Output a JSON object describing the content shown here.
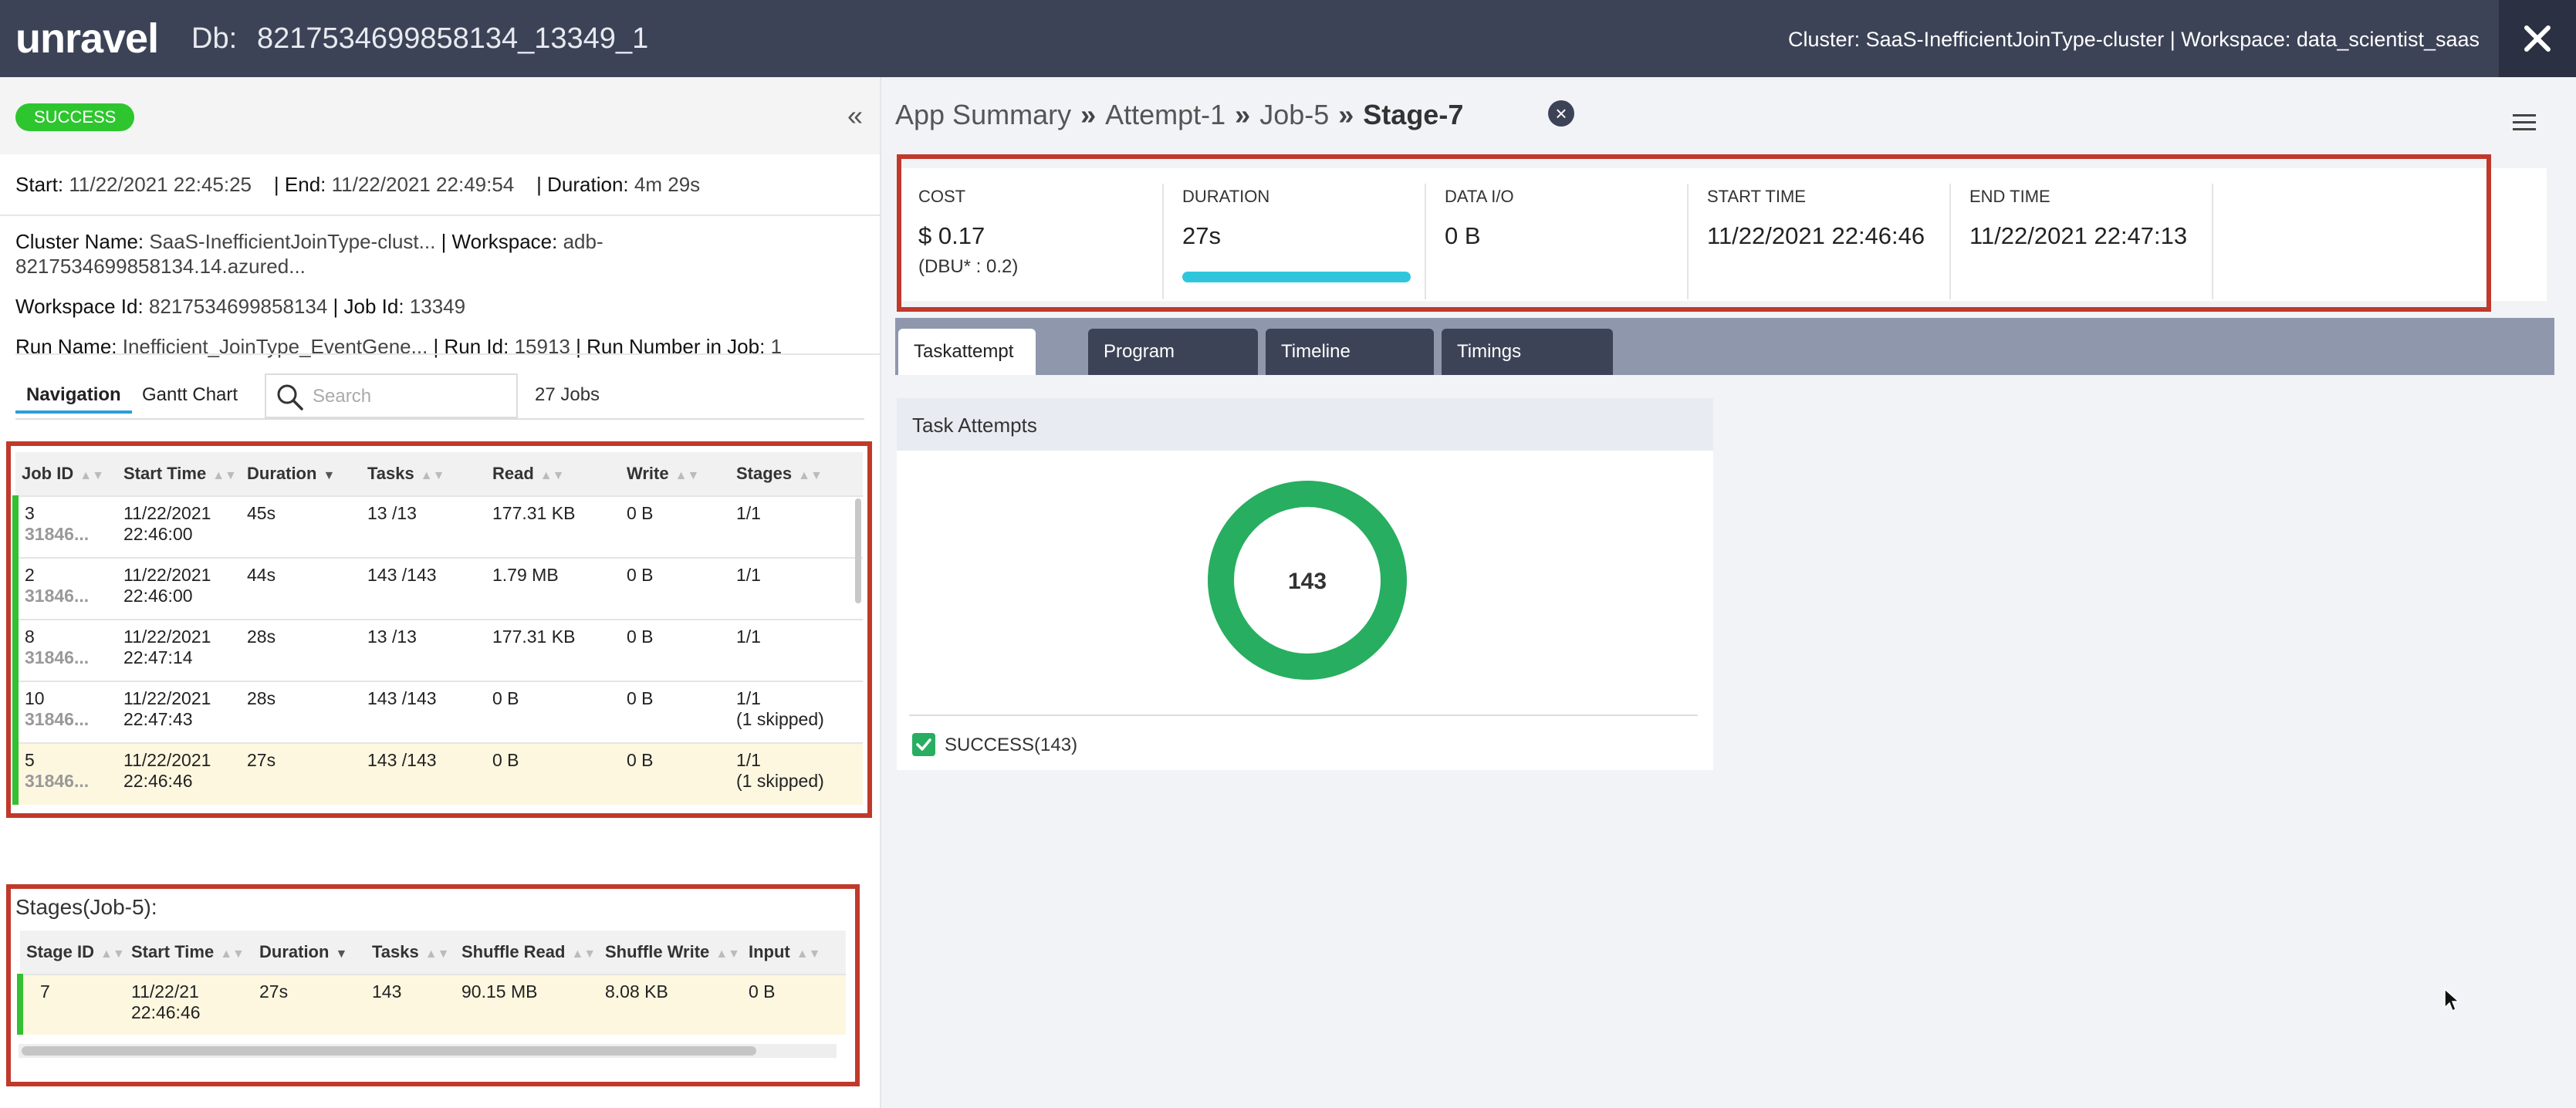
{
  "topbar": {
    "logo": "unravel",
    "db_label": "Db:",
    "db_value": "8217534699858134_13349_1",
    "cluster_workspace": "Cluster: SaaS-InefficientJoinType-cluster | Workspace: data_scientist_saas"
  },
  "status": "SUCCESS",
  "run_info": {
    "start_label": "Start:",
    "start": "11/22/2021 22:45:25",
    "end_label": "| End:",
    "end": "11/22/2021 22:49:54",
    "duration_label": "| Duration:",
    "duration": "4m 29s",
    "cluster_label": "Cluster Name:",
    "cluster": "SaaS-InefficientJoinType-clust...",
    "workspace_label": "| Workspace:",
    "workspace_line1": "adb-",
    "workspace_line2": "8217534699858134.14.azured...",
    "workspace_id_label": "Workspace Id:",
    "workspace_id": "8217534699858134",
    "job_id_label": "| Job Id:",
    "job_id": "13349",
    "run_name_label": "Run Name:",
    "run_name": "Inefficient_JoinType_EventGene...",
    "run_id_label": "| Run Id:",
    "run_id": "15913",
    "run_number_label": "| Run Number in Job:",
    "run_number": "1"
  },
  "nav": {
    "tabs": [
      "Navigation",
      "Gantt Chart"
    ],
    "search_placeholder": "Search",
    "jobs_count": "27 Jobs"
  },
  "jobs_table": {
    "columns": [
      "Job ID",
      "Start Time",
      "Duration",
      "Tasks",
      "Read",
      "Write",
      "Stages"
    ],
    "rows": [
      {
        "id": "3",
        "sub": "31846...",
        "start1": "11/22/2021",
        "start2": "22:46:00",
        "duration": "45s",
        "tasks": "13 /13",
        "read": "177.31 KB",
        "write": "0 B",
        "stages": "1/1",
        "stages_note": ""
      },
      {
        "id": "2",
        "sub": "31846...",
        "start1": "11/22/2021",
        "start2": "22:46:00",
        "duration": "44s",
        "tasks": "143 /143",
        "read": "1.79 MB",
        "write": "0 B",
        "stages": "1/1",
        "stages_note": ""
      },
      {
        "id": "8",
        "sub": "31846...",
        "start1": "11/22/2021",
        "start2": "22:47:14",
        "duration": "28s",
        "tasks": "13 /13",
        "read": "177.31 KB",
        "write": "0 B",
        "stages": "1/1",
        "stages_note": ""
      },
      {
        "id": "10",
        "sub": "31846...",
        "start1": "11/22/2021",
        "start2": "22:47:43",
        "duration": "28s",
        "tasks": "143 /143",
        "read": "0 B",
        "write": "0 B",
        "stages": "1/1",
        "stages_note": "(1 skipped)"
      },
      {
        "id": "5",
        "sub": "31846...",
        "start1": "11/22/2021",
        "start2": "22:46:46",
        "duration": "27s",
        "tasks": "143 /143",
        "read": "0 B",
        "write": "0 B",
        "stages": "1/1",
        "stages_note": "(1 skipped)"
      }
    ]
  },
  "stages": {
    "title": "Stages(Job-5):",
    "columns": [
      "Stage ID",
      "Start Time",
      "Duration",
      "Tasks",
      "Shuffle Read",
      "Shuffle Write",
      "Input"
    ],
    "rows": [
      {
        "id": "7",
        "start1": "11/22/21",
        "start2": "22:46:46",
        "duration": "27s",
        "tasks": "143",
        "shuffle_read": "90.15 MB",
        "shuffle_write": "8.08 KB",
        "input": "0 B"
      }
    ]
  },
  "breadcrumb": {
    "items": [
      "App Summary",
      "Attempt-1",
      "Job-5",
      "Stage-7"
    ],
    "separator": "»"
  },
  "metrics": {
    "cost_label": "COST",
    "cost": "$ 0.17",
    "cost_sub": "(DBU* : 0.2)",
    "duration_label": "DURATION",
    "duration": "27s",
    "duration_progress": 1.0,
    "dataio_label": "DATA I/O",
    "dataio": "0 B",
    "start_label": "START TIME",
    "start": "11/22/2021 22:46:46",
    "end_label": "END TIME",
    "end": "11/22/2021 22:47:13"
  },
  "tabs": [
    "Taskattempt",
    "Program",
    "Timeline",
    "Timings"
  ],
  "active_tab": "Taskattempt",
  "task_attempts": {
    "title": "Task Attempts",
    "total": "143",
    "legend": "SUCCESS(143)",
    "success_count": 143,
    "color": "#27ae60"
  },
  "colors": {
    "topbar": "#3d4357",
    "success": "#2ec62e",
    "highlight": "#c0392b",
    "duration_bar": "#2fc6dc"
  }
}
